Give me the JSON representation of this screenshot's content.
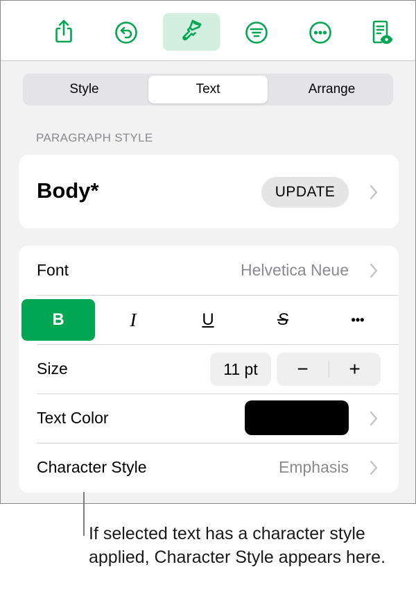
{
  "toolbar": {
    "buttons": [
      {
        "name": "share",
        "icon": "share-icon",
        "active": false
      },
      {
        "name": "undo",
        "icon": "undo-icon",
        "active": false
      },
      {
        "name": "format",
        "icon": "paintbrush-icon",
        "active": true
      },
      {
        "name": "document-setup",
        "icon": "filter-lines-icon",
        "active": false
      },
      {
        "name": "more",
        "icon": "ellipsis-circle-icon",
        "active": false
      },
      {
        "name": "reading-view",
        "icon": "document-eye-icon",
        "active": false
      }
    ],
    "accent_color": "#00a651"
  },
  "tabs": [
    {
      "label": "Style",
      "active": false
    },
    {
      "label": "Text",
      "active": true
    },
    {
      "label": "Arrange",
      "active": false
    }
  ],
  "paragraph_style": {
    "section_label": "PARAGRAPH STYLE",
    "name": "Body*",
    "update_label": "UPDATE"
  },
  "text_settings": {
    "font": {
      "label": "Font",
      "value": "Helvetica Neue"
    },
    "format_buttons": [
      {
        "label": "B",
        "name": "bold",
        "active": true
      },
      {
        "label": "I",
        "name": "italic",
        "active": false
      },
      {
        "label": "U",
        "name": "underline",
        "active": false
      },
      {
        "label": "S",
        "name": "strikethrough",
        "active": false
      },
      {
        "label": "•••",
        "name": "more-options",
        "active": false
      }
    ],
    "size": {
      "label": "Size",
      "value": "11 pt",
      "decrement": "−",
      "increment": "+"
    },
    "text_color": {
      "label": "Text Color",
      "color": "#000000"
    },
    "character_style": {
      "label": "Character Style",
      "value": "Emphasis"
    }
  },
  "callout": {
    "text": "If selected text has a character style applied, Character Style appears here."
  }
}
